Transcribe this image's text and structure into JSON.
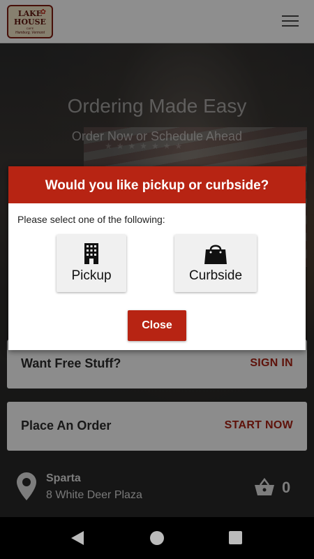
{
  "header": {
    "logo": {
      "line1": "LAKE",
      "line2": "HOUSE",
      "line3": "CAFE",
      "line4": "Hamburg, Vermont"
    },
    "menu_icon": "hamburger-menu-icon"
  },
  "hero": {
    "title": "Ordering Made Easy",
    "subtitle": "Order Now or Schedule Ahead"
  },
  "cards": [
    {
      "label": "Want Free Stuff?",
      "action": "SIGN IN"
    },
    {
      "label": "Place An Order",
      "action": "START NOW"
    }
  ],
  "location": {
    "city": "Sparta",
    "address": "8 White Deer Plaza",
    "icon": "map-pin-icon"
  },
  "cart": {
    "count": "0",
    "icon": "shopping-basket-icon"
  },
  "modal": {
    "title": "Would you like pickup or curbside?",
    "prompt": "Please select one of the following:",
    "options": [
      {
        "label": "Pickup",
        "icon": "building-icon"
      },
      {
        "label": "Curbside",
        "icon": "shopping-bag-icon"
      }
    ],
    "close_label": "Close"
  },
  "colors": {
    "brand": "#b72413",
    "action_text": "#a31f12"
  }
}
